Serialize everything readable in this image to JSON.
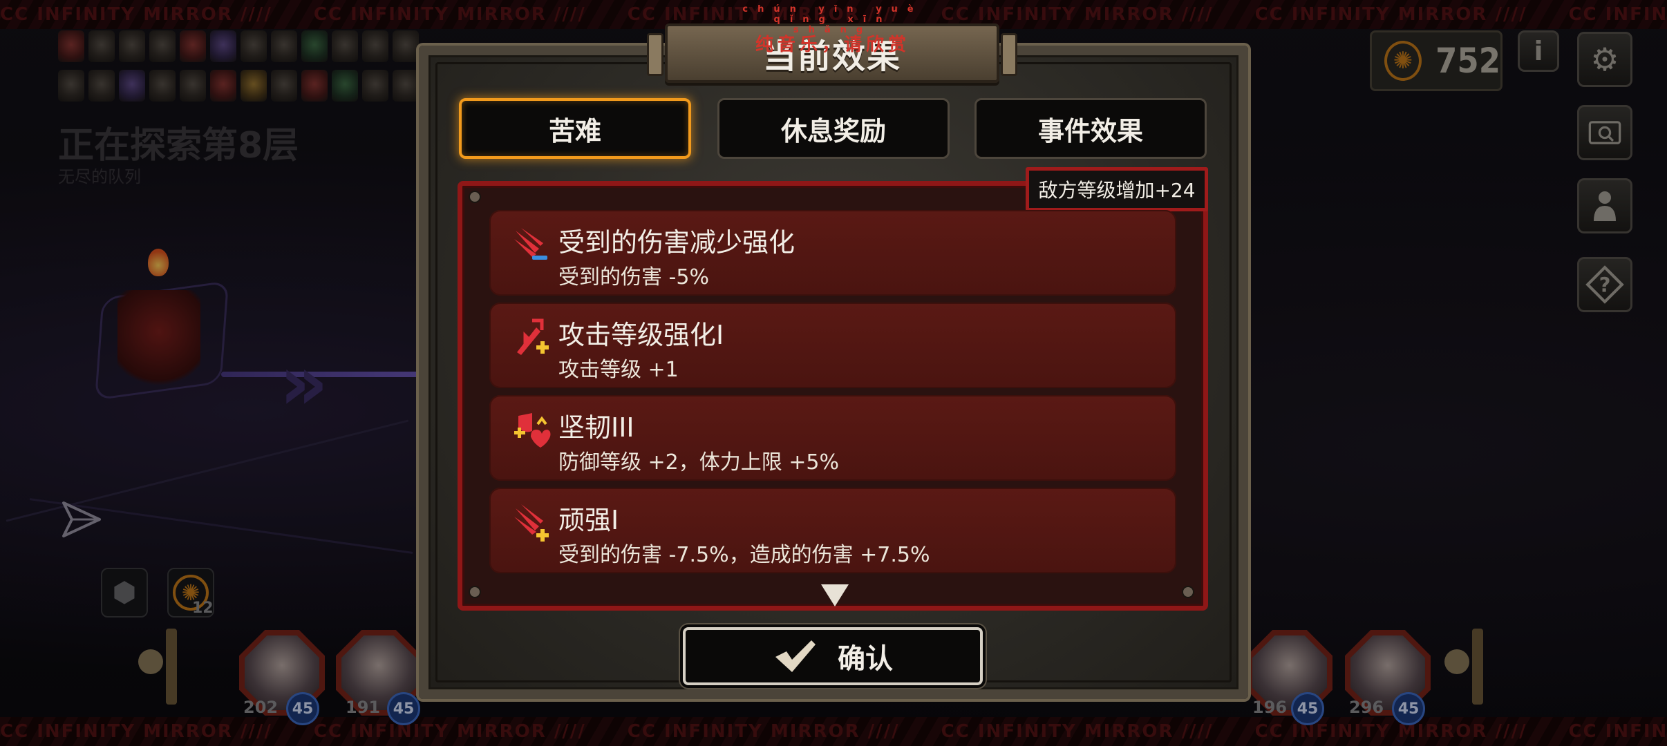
{
  "ticker_text": "CC INFINITY MIRROR ////",
  "background": {
    "floor_title": "正在探索第8层",
    "floor_subtitle": "无尽的队列",
    "counter_small": "12",
    "heroes": [
      {
        "hp": "202",
        "level": "45"
      },
      {
        "hp": "191",
        "level": "45"
      },
      {
        "hp": "196",
        "level": "45"
      },
      {
        "hp": "296",
        "level": "45"
      }
    ]
  },
  "hud": {
    "gold": "752",
    "info_icon": "info-icon",
    "settings_icon": "gear-icon",
    "codex_icon": "codex-icon",
    "team_icon": "person-icon",
    "help_icon": "question-icon"
  },
  "music_banner": {
    "pinyin": "chún yīn yuè  qǐng xīn shǎng",
    "text": "纯音乐，请欣赏"
  },
  "modal": {
    "title": "当前效果",
    "tabs": [
      {
        "label": "苦难",
        "active": true
      },
      {
        "label": "休息奖励",
        "active": false
      },
      {
        "label": "事件效果",
        "active": false
      }
    ],
    "enemy_level_badge": "敌方等级增加+24",
    "effects": [
      {
        "name": "受到的伤害减少强化",
        "desc": "受到的伤害 -5%",
        "icon": "damage-reduction-icon"
      },
      {
        "name": "攻击等级强化I",
        "desc": "攻击等级 +1",
        "icon": "attack-up-icon"
      },
      {
        "name": "坚韧III",
        "desc": "防御等级 +2，体力上限 +5%",
        "icon": "shield-heart-icon"
      },
      {
        "name": "顽强I",
        "desc": "受到的伤害 -7.5%，造成的伤害 +7.5%",
        "icon": "tenacity-icon"
      }
    ],
    "confirm_label": "确认"
  },
  "colors": {
    "accent_orange": "#f29a1c",
    "panel_red": "#8f1717",
    "gold": "#c57a1a"
  }
}
